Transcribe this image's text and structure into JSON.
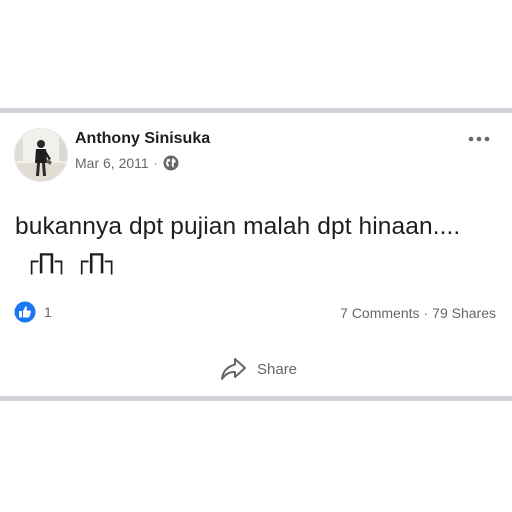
{
  "post": {
    "author": "Anthony Sinisuka",
    "date": "Mar 6, 2011",
    "privacy_separator": "·",
    "privacy_icon": "globe-icon",
    "text": "bukannya dpt pujian malah dpt hinaan....",
    "emoticon": "┌∏┐ ┌∏┐"
  },
  "reactions": {
    "icon": "like-icon",
    "count": "1"
  },
  "stats": {
    "comments": "7 Comments",
    "separator": "·",
    "shares": "79 Shares"
  },
  "actions": {
    "share_label": "Share",
    "share_icon": "share-arrow-icon"
  },
  "menu": {
    "icon": "more-options-icon"
  },
  "colors": {
    "like_blue": "#1877f2",
    "divider": "#cfd2d7",
    "text": "#1c1e21",
    "muted": "#65676b"
  }
}
